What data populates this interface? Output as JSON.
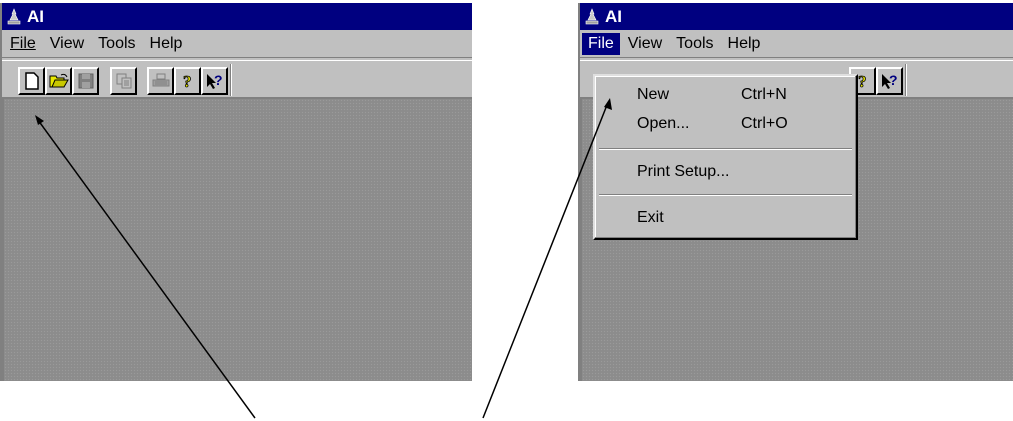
{
  "app_title": "AI",
  "menu": {
    "file": "File",
    "view": "View",
    "tools": "Tools",
    "help": "Help"
  },
  "toolbar": {
    "buttons": [
      "new-icon",
      "open-icon",
      "save-icon",
      "copy-icon",
      "print-icon",
      "help-icon",
      "context-help-icon"
    ]
  },
  "file_menu": {
    "items": [
      {
        "label": "New",
        "shortcut": "Ctrl+N"
      },
      {
        "label": "Open...",
        "shortcut": "Ctrl+O"
      },
      {
        "label": "Print Setup...",
        "shortcut": ""
      },
      {
        "label": "Exit",
        "shortcut": ""
      }
    ]
  },
  "colors": {
    "titlebar": "#000080",
    "face": "#c0c0c0",
    "client": "#8c8c8c",
    "highlight": "#000080"
  }
}
